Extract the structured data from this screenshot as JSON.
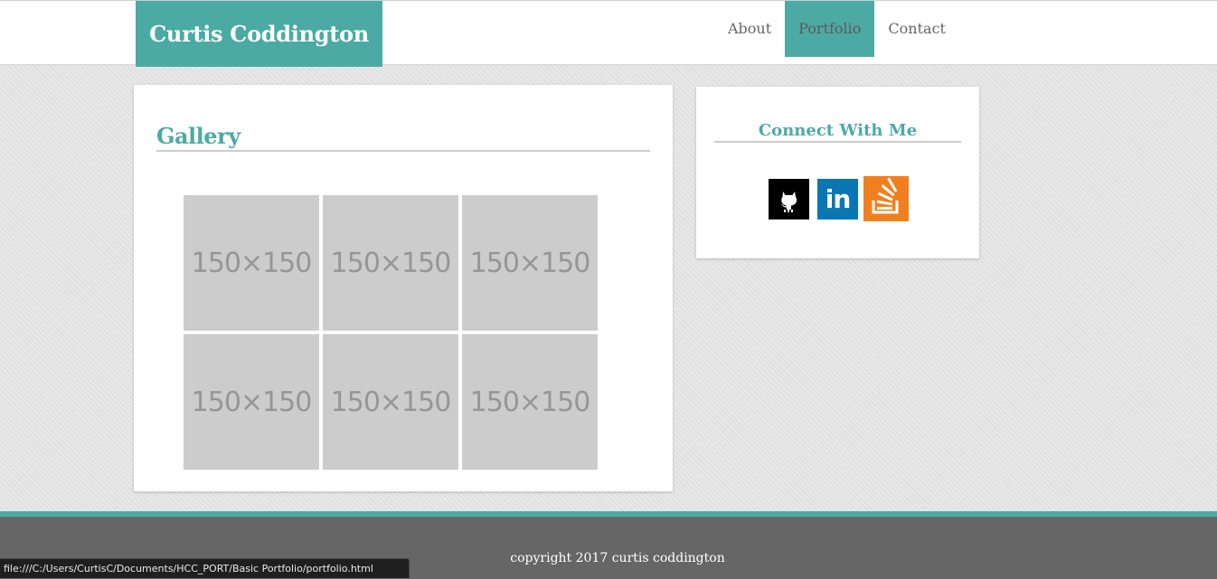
{
  "header": {
    "brand": "Curtis Coddington",
    "nav": [
      {
        "label": "About",
        "active": false
      },
      {
        "label": "Portfolio",
        "active": true
      },
      {
        "label": "Contact",
        "active": false
      }
    ]
  },
  "gallery": {
    "title": "Gallery",
    "thumbnails": [
      "150×150",
      "150×150",
      "150×150",
      "150×150",
      "150×150",
      "150×150"
    ]
  },
  "sidebar": {
    "title": "Connect With Me",
    "social": [
      {
        "name": "github-icon",
        "color": "#000000"
      },
      {
        "name": "linkedin-icon",
        "label": "in",
        "color": "#0a77b5"
      },
      {
        "name": "stackoverflow-icon",
        "color": "#f0801f"
      }
    ]
  },
  "footer": {
    "copyright": "copyright 2017 curtis coddington"
  },
  "statusbar": {
    "url": "file:///C:/Users/CurtisC/Documents/HCC_PORT/Basic Portfolio/portfolio.html"
  },
  "colors": {
    "accent": "#4caaa4",
    "footer": "#666666",
    "thumb_bg": "#cccccc",
    "thumb_text": "#969696"
  }
}
